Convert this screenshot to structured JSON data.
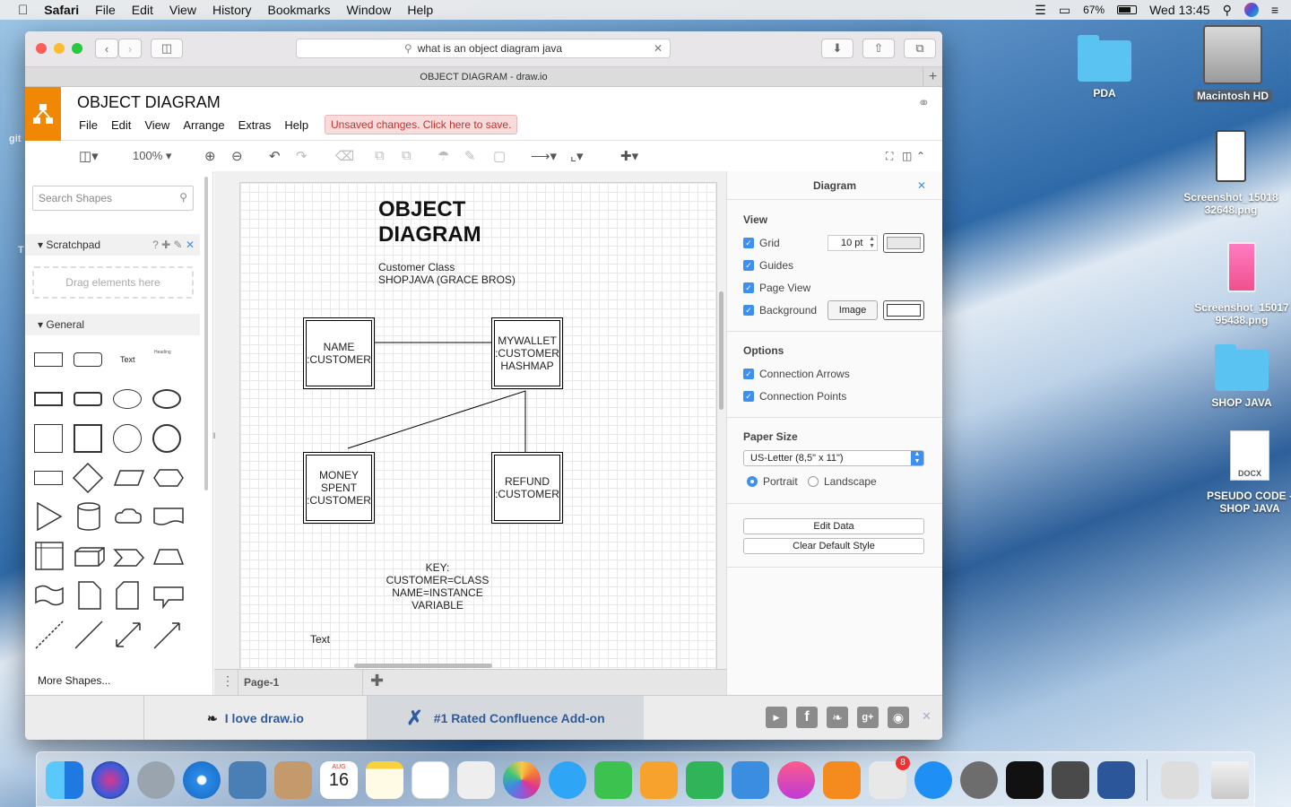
{
  "menubar": {
    "app": "Safari",
    "items": [
      "File",
      "Edit",
      "View",
      "History",
      "Bookmarks",
      "Window",
      "Help"
    ],
    "battery": "67%",
    "clock": "Wed 13:45"
  },
  "desktop": {
    "icons": [
      {
        "label": "PDA"
      },
      {
        "label": "Macintosh HD"
      },
      {
        "label": "Screenshot_15018\n32648.png"
      },
      {
        "label": "Screenshot_15017\n95438.png"
      },
      {
        "label": "SHOP JAVA"
      },
      {
        "label": "PSEUDO CODE - SHOP JAVA"
      }
    ],
    "partial_left": "git",
    "partial_left2": "T"
  },
  "browser": {
    "url": "what is an object diagram java",
    "tab_title": "OBJECT DIAGRAM - draw.io"
  },
  "drawio": {
    "title": "OBJECT DIAGRAM",
    "menu": [
      "File",
      "Edit",
      "View",
      "Arrange",
      "Extras",
      "Help"
    ],
    "unsaved": "Unsaved changes. Click here to save.",
    "zoom": "100%",
    "search_placeholder": "Search Shapes",
    "scratchpad": "Scratchpad",
    "dropzone": "Drag elements here",
    "general": "General",
    "more_shapes": "More Shapes...",
    "shape_text": "Text",
    "shape_heading": "Heading",
    "page_tab": "Page-1"
  },
  "diagram": {
    "title_line1": "OBJECT",
    "title_line2": "DIAGRAM",
    "subtitle_line1": "Customer Class",
    "subtitle_line2": "SHOPJAVA (GRACE BROS)",
    "box_name": "NAME\n:CUSTOMER",
    "box_wallet": "MYWALLET\n:CUSTOMER\nHASHMAP",
    "box_money": "MONEY\nSPENT\n:CUSTOMER",
    "box_refund": "REFUND\n:CUSTOMER",
    "key": "KEY:\nCUSTOMER=CLASS\nNAME=INSTANCE\nVARIABLE",
    "free_text": "Text"
  },
  "panel": {
    "title": "Diagram",
    "view_label": "View",
    "grid": "Grid",
    "grid_size": "10 pt",
    "guides": "Guides",
    "page_view": "Page View",
    "background": "Background",
    "image_btn": "Image",
    "options_label": "Options",
    "conn_arrows": "Connection Arrows",
    "conn_points": "Connection Points",
    "paper_label": "Paper Size",
    "paper_value": "US-Letter (8,5\" x 11\")",
    "portrait": "Portrait",
    "landscape": "Landscape",
    "edit_data": "Edit Data",
    "clear_style": "Clear Default Style"
  },
  "footer": {
    "love": "I love draw.io",
    "confluence": "#1 Rated Confluence Add-on"
  },
  "dock": {
    "calendar_month": "AUG",
    "calendar_day": "16",
    "badge": "8"
  },
  "colors": {
    "drawio_orange": "#f08705",
    "accent_blue": "#3d8ff0",
    "unsaved_red": "#c4302b"
  }
}
